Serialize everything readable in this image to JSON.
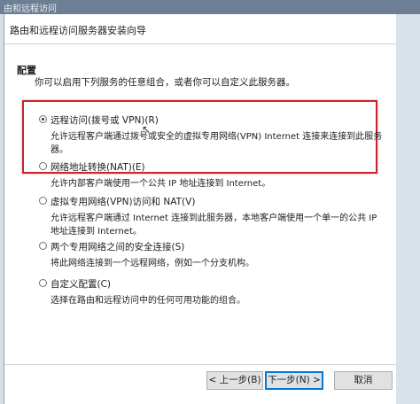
{
  "window": {
    "title": "由和远程访问"
  },
  "wizard": {
    "title": "路由和远程访问服务器安装向导",
    "section_title": "配置",
    "section_desc": "你可以启用下列服务的任意组合，或者你可以自定义此服务器。",
    "options": [
      {
        "label": "远程访问(拨号或 VPN)(R)",
        "desc": "允许远程客户端通过拨号或安全的虚拟专用网络(VPN) Internet 连接来连接到此服务器。",
        "selected": true
      },
      {
        "label": "网络地址转换(NAT)(E)",
        "desc": "允许内部客户端使用一个公共 IP 地址连接到 Internet。",
        "selected": false
      },
      {
        "label": "虚拟专用网络(VPN)访问和 NAT(V)",
        "desc": "允许远程客户端通过 Internet 连接到此服务器，本地客户端使用一个单一的公共 IP 地址连接到 Internet。",
        "selected": false
      },
      {
        "label": "两个专用网络之间的安全连接(S)",
        "desc": "将此网络连接到一个远程网络，例如一个分支机构。",
        "selected": false
      },
      {
        "label": "自定义配置(C)",
        "desc": "选择在路由和远程访问中的任何可用功能的组合。",
        "selected": false
      }
    ],
    "buttons": {
      "back": "< 上一步(B)",
      "next": "下一步(N) >",
      "cancel": "取消"
    }
  },
  "colors": {
    "highlight": "#c8242b",
    "titlebar": "#6d7f95",
    "primary_border": "#0078d7"
  }
}
